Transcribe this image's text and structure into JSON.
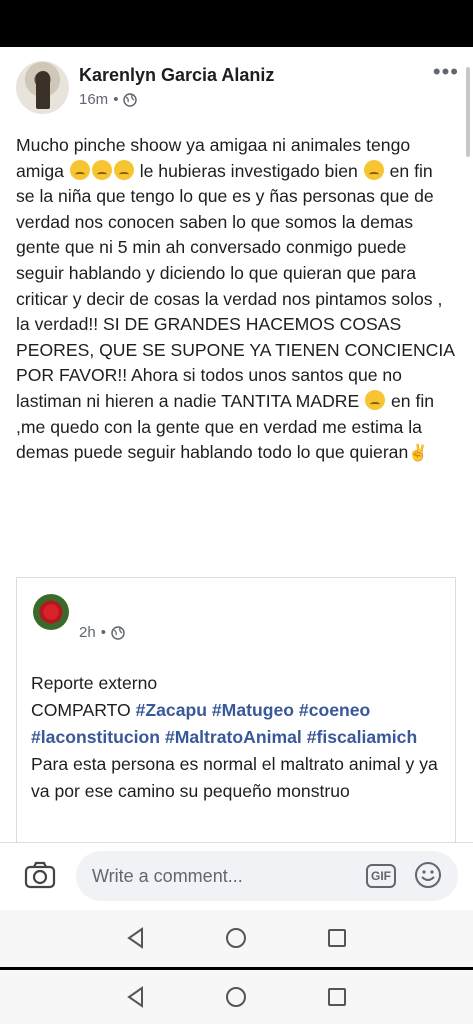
{
  "post": {
    "author": "Karenlyn Garcia Alaniz",
    "time": "16m",
    "privacy_icon": "globe-icon",
    "more_icon": "more-options-icon",
    "text_segments": [
      "Mucho pinche shoow ya amigaa ni animales tengo amiga ",
      " le hubieras investigado bien ",
      " en fin se la niña que tengo lo que es y ñas personas que de verdad nos conocen saben lo que somos la demas gente que ni 5 min ah conversado conmigo puede seguir hablando y diciendo lo que quieran que para criticar y decir de cosas la verdad nos pintamos solos , la verdad!! SI DE GRANDES HACEMOS COSAS PEORES, QUE SE SUPONE YA TIENEN CONCIENCIA POR FAVOR!! Ahora si todos unos santos que no lastiman ni hieren a nadie TANTITA MADRE ",
      " en fin ,me quedo con la gente que en verdad me estima la demas puede seguir hablando todo lo que quieran"
    ]
  },
  "shared": {
    "time": "2h",
    "privacy_icon": "globe-icon",
    "line1": "Reporte externo",
    "compart": "COMPARTO ",
    "tags": [
      "#Zacapu",
      "#Matugeo",
      "#coeneo",
      "#laconstitucion",
      "#MaltratoAnimal",
      "#fiscaliamich"
    ],
    "body": "Para esta persona es normal el maltrato animal y ya va por ese camino su pequeño monstruo"
  },
  "comment_bar": {
    "placeholder": "Write a comment...",
    "gif_label": "GIF",
    "camera_icon": "camera-icon",
    "emoji_icon": "smiley-icon"
  },
  "colors": {
    "link": "#385898",
    "secondary_text": "#606770",
    "input_bg": "#f0f2f5"
  }
}
